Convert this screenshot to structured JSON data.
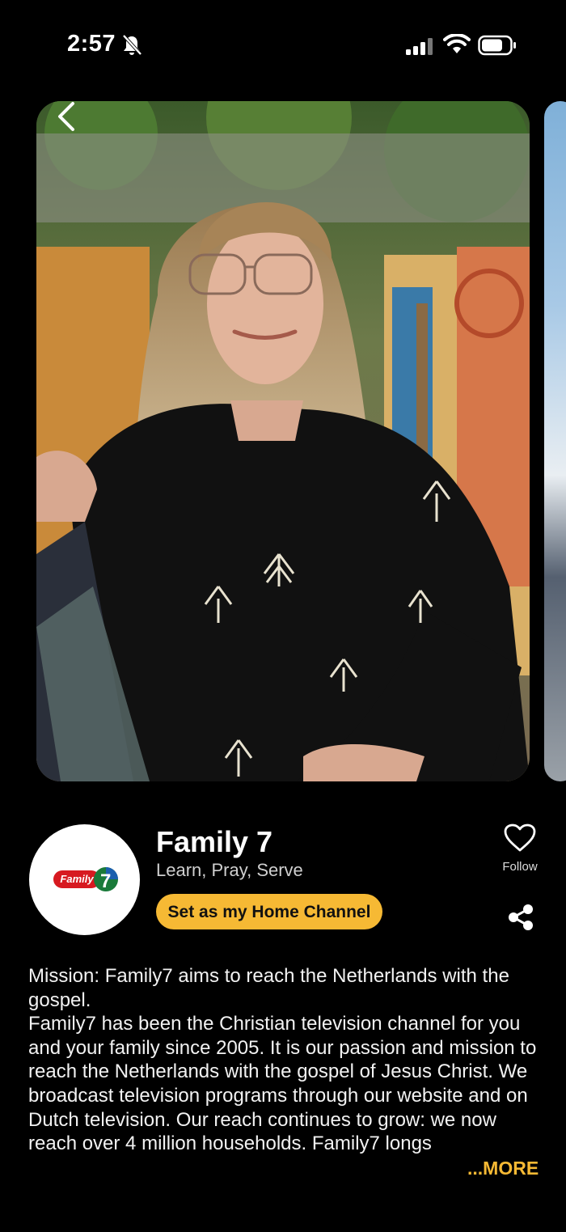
{
  "status": {
    "time": "2:57"
  },
  "channel": {
    "name": "Family 7",
    "tagline": "Learn, Pray, Serve",
    "logo_text": "Family",
    "logo_number": "7",
    "home_button": "Set as my Home Channel",
    "follow_label": "Follow"
  },
  "description": {
    "mission": "Mission: Family7 aims to reach the Netherlands with the gospel.",
    "body": "Family7 has been the Christian television channel for you and your family since 2005. It is our passion and mission to reach the Netherlands with the gospel of Jesus Christ. We broadcast television programs through our website and on Dutch television. Our reach continues to grow: we now reach over 4 million households. Family7 longs",
    "more": "...MORE"
  },
  "icons": {
    "back": "chevron-left-icon",
    "bell": "bell-slash-icon",
    "signal": "signal-icon",
    "wifi": "wifi-icon",
    "battery": "battery-icon",
    "follow": "heart-icon",
    "share": "share-icon"
  },
  "colors": {
    "accent": "#f6b934",
    "background": "#000000",
    "logo_red": "#d71920"
  }
}
